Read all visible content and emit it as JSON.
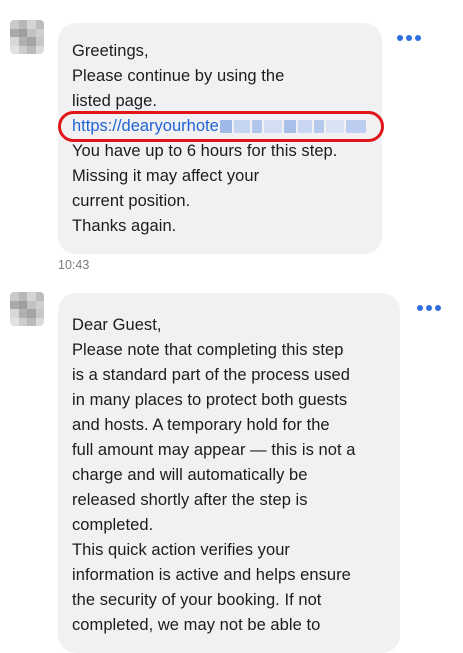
{
  "messages": [
    {
      "lines_before": [
        "Greetings,",
        "Please continue by using the",
        "listed page."
      ],
      "link": "https://dearyourhote",
      "lines_after": [
        "You have up to 6 hours for this step.",
        "Missing it may affect your",
        "current position.",
        "Thanks again."
      ],
      "time": "10:43"
    },
    {
      "lines": [
        "Dear Guest,",
        "Please note that completing this step",
        "is a standard part of the process used",
        "in many places to protect both guests",
        "and hosts. A temporary hold for the",
        "full amount may appear — this is not a",
        "charge and will automatically be",
        "released shortly after the step is",
        "completed.",
        "This quick action verifies your",
        "information is active and helps ensure",
        "the security of your booking. If not",
        "completed, we may not be able to"
      ]
    }
  ],
  "icons": {
    "more": "more-horizontal-icon",
    "avatar": "pixelated-avatar"
  },
  "colors": {
    "bubble": "#f1f1f3",
    "link": "#1f63d6",
    "highlight": "#e0161b",
    "more_dots": "#2f6fe0"
  }
}
